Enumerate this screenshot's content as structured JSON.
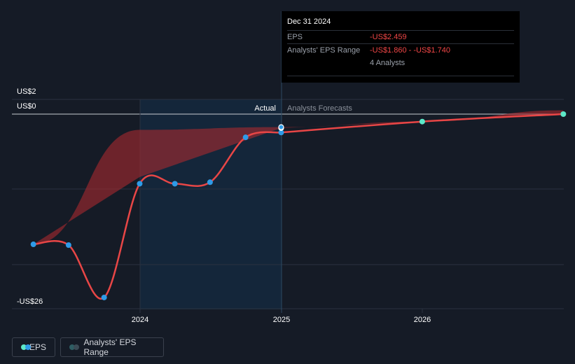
{
  "tooltip": {
    "date": "Dec 31 2024",
    "eps_label": "EPS",
    "eps_value": "-US$2.459",
    "range_label": "Analysts' EPS Range",
    "range_value": "-US$1.860 - -US$1.740",
    "analysts": "4 Analysts"
  },
  "region_labels": {
    "actual": "Actual",
    "forecast": "Analysts Forecasts"
  },
  "legend": {
    "eps": "EPS",
    "range": "Analysts' EPS Range"
  },
  "colors": {
    "background": "#151b26",
    "eps_line": "#e84646",
    "eps_point": "#2e9be8",
    "forecast_point": "#5de8c8",
    "range_fill": "#a82a2e",
    "actual_shade": "#14304a"
  },
  "chart_data": {
    "type": "line",
    "y_tick_labels": [
      "US$2",
      "US$0",
      "-US$26"
    ],
    "ylim": [
      -26,
      2
    ],
    "x_tick_labels": [
      "2024",
      "2025",
      "2026"
    ],
    "series": [
      {
        "name": "EPS",
        "points": [
          {
            "x": "2023-03-31",
            "y": -17.4
          },
          {
            "x": "2023-06-30",
            "y": -17.5
          },
          {
            "x": "2023-09-30",
            "y": -24.5
          },
          {
            "x": "2023-12-31",
            "y": -9.3
          },
          {
            "x": "2024-03-31",
            "y": -9.3
          },
          {
            "x": "2024-06-30",
            "y": -9.1
          },
          {
            "x": "2024-09-30",
            "y": -3.1
          },
          {
            "x": "2024-12-31",
            "y": -2.459
          }
        ]
      },
      {
        "name": "EPS forecast",
        "points": [
          {
            "x": "2024-12-31",
            "y": -2.459
          },
          {
            "x": "2025-12-31",
            "y": -1.0
          },
          {
            "x": "2026-12-31",
            "y": 0.0
          }
        ]
      },
      {
        "name": "Analysts' EPS Range",
        "range": [
          {
            "x": "2023-03-31",
            "low": -17.4,
            "high": -17.4
          },
          {
            "x": "2023-12-31",
            "low": -8.4,
            "high": -2.1
          },
          {
            "x": "2024-12-31",
            "low": -1.86,
            "high": -1.74
          },
          {
            "x": "2025-12-31",
            "low": -1.0,
            "high": -1.0
          },
          {
            "x": "2026-12-31",
            "low": -0.1,
            "high": 0.5
          }
        ]
      }
    ],
    "markers": [
      {
        "x": "2024-12-31",
        "y": -1.86
      },
      {
        "x": "2024-12-31",
        "y": -1.74
      }
    ]
  }
}
